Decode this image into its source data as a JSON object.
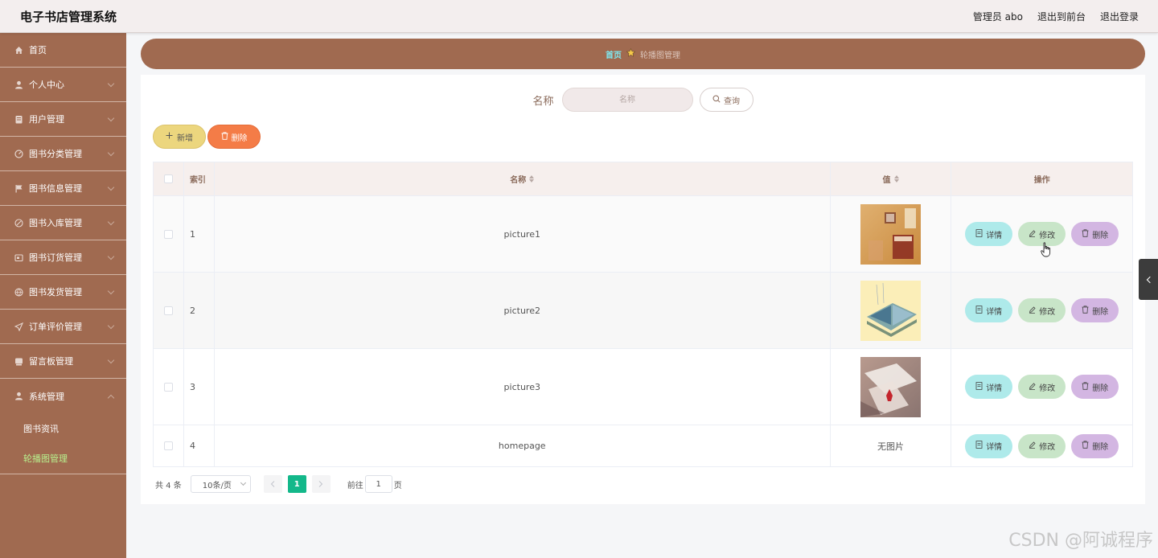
{
  "header": {
    "title": "电子书店管理系统",
    "admin": "管理员 abo",
    "to_front": "退出到前台",
    "logout": "退出登录"
  },
  "sidebar": {
    "items": [
      {
        "label": "首页",
        "icon": "home-icon"
      },
      {
        "label": "个人中心",
        "icon": "user-icon"
      },
      {
        "label": "用户管理",
        "icon": "users-icon"
      },
      {
        "label": "图书分类管理",
        "icon": "category-icon"
      },
      {
        "label": "图书信息管理",
        "icon": "flag-icon"
      },
      {
        "label": "图书入库管理",
        "icon": "warehouse-icon"
      },
      {
        "label": "图书订货管理",
        "icon": "order-icon"
      },
      {
        "label": "图书发货管理",
        "icon": "shipping-icon"
      },
      {
        "label": "订单评价管理",
        "icon": "send-icon"
      },
      {
        "label": "留言板管理",
        "icon": "board-icon"
      },
      {
        "label": "系统管理",
        "icon": "system-icon"
      }
    ],
    "sub_items": [
      {
        "label": "图书资讯"
      },
      {
        "label": "轮播图管理"
      }
    ]
  },
  "breadcrumb": {
    "home": "首页",
    "current": "轮播图管理"
  },
  "search": {
    "label": "名称",
    "placeholder": "名称",
    "button": "查询"
  },
  "actions": {
    "add": "新增",
    "delete": "删除"
  },
  "table": {
    "headers": {
      "index": "索引",
      "name": "名称",
      "value": "值",
      "ops": "操作"
    },
    "rows": [
      {
        "index": "1",
        "name": "picture1",
        "value": ""
      },
      {
        "index": "2",
        "name": "picture2",
        "value": ""
      },
      {
        "index": "3",
        "name": "picture3",
        "value": ""
      },
      {
        "index": "4",
        "name": "homepage",
        "value": "无图片"
      }
    ],
    "op_labels": {
      "detail": "详情",
      "edit": "修改",
      "delete": "删除"
    }
  },
  "pagination": {
    "total": "共 4 条",
    "page_size": "10条/页",
    "current_page": "1",
    "goto_prefix": "前往",
    "goto_value": "1",
    "goto_suffix": "页"
  },
  "watermark": "CSDN @阿诚程序",
  "colors": {
    "primary": "#a06a50",
    "accent_green": "#13b88a",
    "add_button": "#ecd67e",
    "delete_button": "#f47c47",
    "detail_button": "#aeeaea",
    "edit_button": "#c8e5c8",
    "row_delete_button": "#d3b6e2"
  }
}
